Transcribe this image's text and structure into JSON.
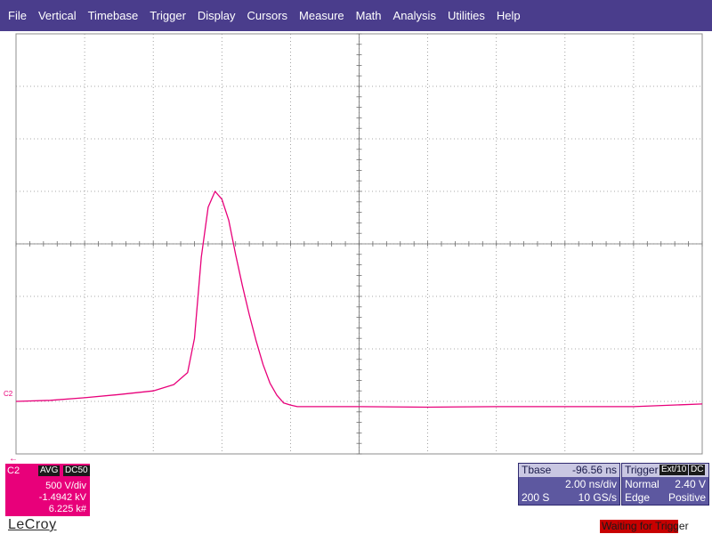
{
  "menu": [
    "File",
    "Vertical",
    "Timebase",
    "Trigger",
    "Display",
    "Cursors",
    "Measure",
    "Math",
    "Analysis",
    "Utilities",
    "Help"
  ],
  "channel": {
    "label": "C2",
    "tags": [
      "AVG",
      "DC50"
    ],
    "volts_per_div": "500 V/div",
    "offset": "-1.4942 kV",
    "sweeps": "6.225 k#"
  },
  "timebase": {
    "title": "Tbase",
    "delay": "-96.56 ns",
    "time_per_div": "2.00 ns/div",
    "samples": "200 S",
    "rate": "10 GS/s"
  },
  "trigger": {
    "title": "Trigger",
    "tags": [
      "Ext/10",
      "DC"
    ],
    "mode": "Normal",
    "level": "2.40 V",
    "type": "Edge",
    "slope": "Positive"
  },
  "brand": "LeCroy",
  "status": "Waiting for Trigger",
  "colors": {
    "trace": "#e8007a",
    "menubar": "#4a3d8c",
    "grid": "#8c8c8c"
  },
  "chart_data": {
    "type": "line",
    "title": "",
    "xlabel": "",
    "ylabel": "",
    "x_divisions": 10,
    "y_divisions": 8,
    "x_unit": "div",
    "y_unit": "div",
    "grid": true,
    "series": [
      {
        "x": [
          0,
          0.5,
          1,
          1.5,
          2,
          2.3,
          2.5,
          2.6,
          2.7,
          2.8,
          2.9,
          3.0,
          3.1,
          3.2,
          3.3,
          3.4,
          3.5,
          3.6,
          3.7,
          3.8,
          3.9,
          4.0,
          4.1,
          4.2,
          4.3,
          4.5,
          5,
          6,
          7,
          8,
          9,
          10
        ],
        "y": [
          -3.0,
          -2.98,
          -2.93,
          -2.87,
          -2.8,
          -2.68,
          -2.45,
          -1.8,
          -0.25,
          0.7,
          1.0,
          0.85,
          0.45,
          -0.2,
          -0.8,
          -1.35,
          -1.85,
          -2.3,
          -2.65,
          -2.88,
          -3.03,
          -3.07,
          -3.1,
          -3.1,
          -3.1,
          -3.1,
          -3.1,
          -3.11,
          -3.1,
          -3.1,
          -3.1,
          -3.05
        ]
      }
    ]
  }
}
